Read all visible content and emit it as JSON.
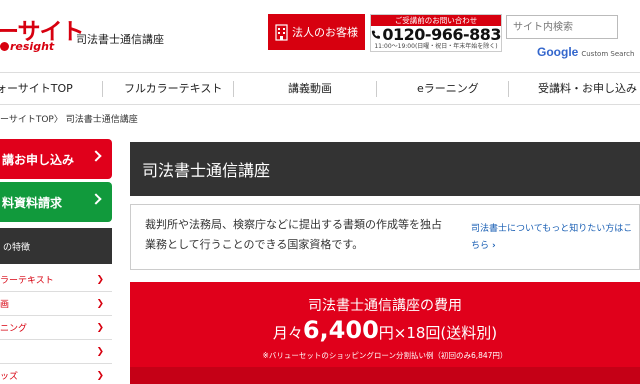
{
  "header": {
    "logo_main": "ーサイト",
    "logo_sub": "resight",
    "site_title": "司法書士通信講座",
    "corp_button": "法人のお客様",
    "phone": {
      "top": "ご受講前のお問い合わせ",
      "number": "0120-966-883",
      "hours": "11:00～19:00(日曜・祝日・年末年始を除く)"
    },
    "search": {
      "placeholder": "サイト内検索"
    },
    "google_label": "Google",
    "custom_search": "Custom Search"
  },
  "nav": {
    "items": [
      "ォーサイトTOP",
      "フルカラーテキスト",
      "講義動画",
      "eラーニング",
      "受講料・お申し込み"
    ]
  },
  "breadcrumb": "ーサイトTOP〉 司法書士通信講座",
  "sidebar": {
    "apply_button": "講お申し込み",
    "material_button": "料資料請求",
    "features_head": "の特徴",
    "items": [
      "ラーテキスト",
      "画",
      "ニング",
      "",
      "ッズ"
    ]
  },
  "main": {
    "title": "司法書士通信講座",
    "description": "裁判所や法務局、検察庁などに提出する書類の作成等を独占業務として行うことのできる国家資格です。",
    "link_text": "司法書士についてもっと知りたい方はこちら",
    "price": {
      "title": "司法書士通信講座の費用",
      "prefix": "月々",
      "amount": "6,400",
      "suffix": "円×18回(送料別)",
      "note": "※バリューセットのショッピングローン分割払い例（初回のみ6,847円）"
    }
  },
  "colors": {
    "brand_red": "#d7000f",
    "green": "#119a3c",
    "dark": "#333333",
    "link": "#1a5fb4"
  }
}
